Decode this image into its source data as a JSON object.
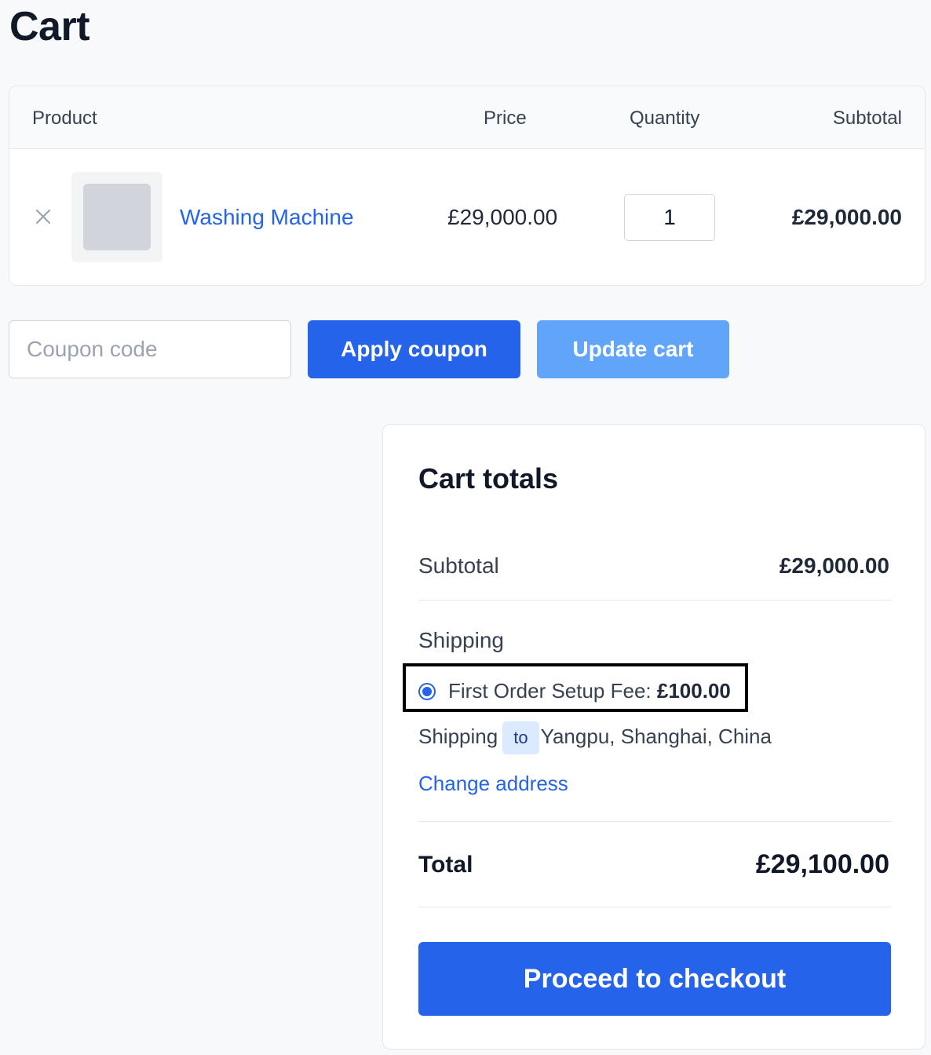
{
  "page": {
    "title": "Cart"
  },
  "table": {
    "headers": {
      "product": "Product",
      "price": "Price",
      "quantity": "Quantity",
      "subtotal": "Subtotal"
    },
    "rows": [
      {
        "name": "Washing Machine",
        "price": "£29,000.00",
        "quantity": "1",
        "subtotal": "£29,000.00"
      }
    ]
  },
  "coupon": {
    "placeholder": "Coupon code",
    "apply_label": "Apply coupon",
    "update_label": "Update cart"
  },
  "totals": {
    "title": "Cart totals",
    "subtotal_label": "Subtotal",
    "subtotal_value": "£29,000.00",
    "shipping_label": "Shipping",
    "shipping_option_label": "First Order Setup Fee:",
    "shipping_option_price": "£100.00",
    "shipping_dest_prefix": "Shipping",
    "shipping_dest_to": "to",
    "shipping_dest_location": "Yangpu, Shanghai, China",
    "change_address": "Change address",
    "total_label": "Total",
    "total_value": "£29,100.00",
    "checkout_label": "Proceed to checkout"
  },
  "icons": {
    "remove": "close-icon",
    "radio": "radio-selected"
  },
  "colors": {
    "accent": "#2563eb",
    "accent_light": "#60a5fa",
    "badge_bg": "#dbeafe",
    "background": "#f8f9fb"
  }
}
